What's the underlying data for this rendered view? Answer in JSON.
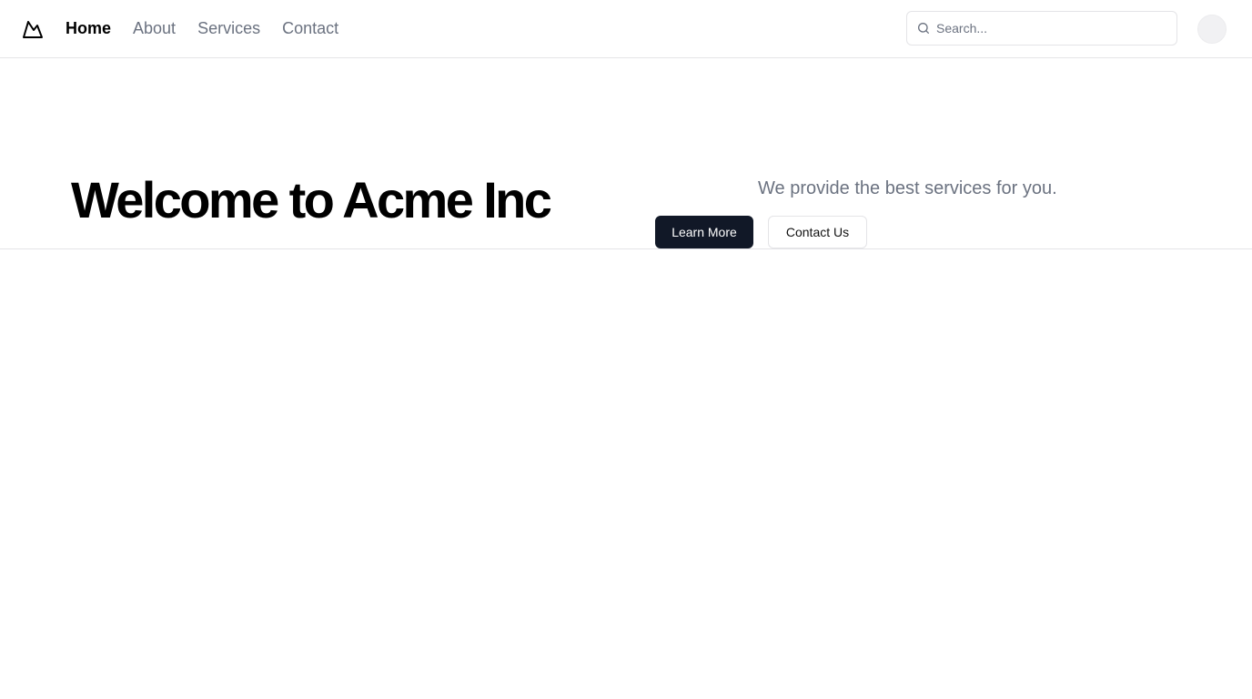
{
  "header": {
    "logo_icon": "mountain-icon",
    "nav": [
      {
        "label": "Home",
        "active": true
      },
      {
        "label": "About",
        "active": false
      },
      {
        "label": "Services",
        "active": false
      },
      {
        "label": "Contact",
        "active": false
      }
    ],
    "search": {
      "icon": "search-icon",
      "placeholder": "Search...",
      "value": ""
    },
    "avatar_icon": "avatar"
  },
  "hero": {
    "title": "Welcome to Acme Inc",
    "subtitle": "We provide the best services for you.",
    "primary_button": "Learn More",
    "secondary_button": "Contact Us"
  },
  "colors": {
    "primary_button_bg": "#111827",
    "muted_text": "#6b7280",
    "border": "#e4e4e7"
  }
}
